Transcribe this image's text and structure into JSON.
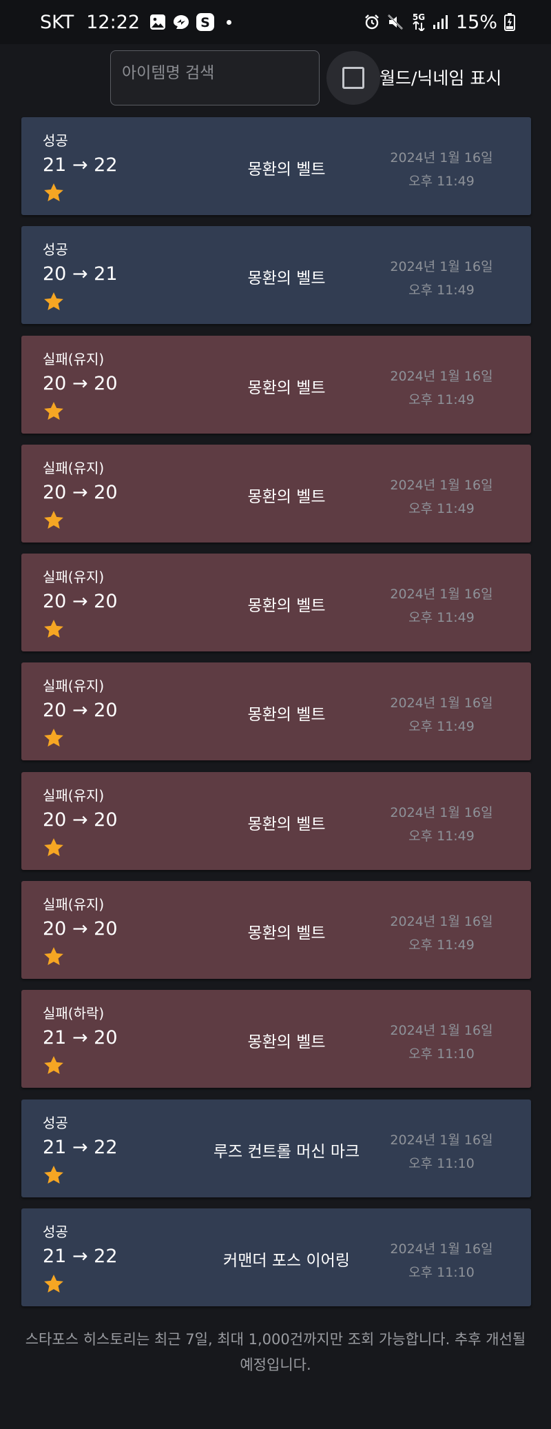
{
  "status_bar": {
    "carrier": "SKT",
    "time": "12:22",
    "network": "5G",
    "battery": "15%",
    "icons": [
      "gallery-icon",
      "messenger-icon",
      "s-app-icon",
      "notification-dot-icon",
      "alarm-icon",
      "mute-icon",
      "data-arrows-icon",
      "signal-icon",
      "battery-charging-icon"
    ]
  },
  "search": {
    "placeholder": "아이템명 검색",
    "value": ""
  },
  "world_toggle": {
    "label": "월드/닉네임 표시",
    "checked": false
  },
  "star_color": "#f6a623",
  "colors": {
    "success_card": "#323d52",
    "fail_card": "#5e3c43",
    "background": "#17181c"
  },
  "records": [
    {
      "result": "성공",
      "levels": "21 → 22",
      "item": "몽환의 벨트",
      "date": "2024년 1월 16일",
      "time": "오후 11:49",
      "status": "success"
    },
    {
      "result": "성공",
      "levels": "20 → 21",
      "item": "몽환의 벨트",
      "date": "2024년 1월 16일",
      "time": "오후 11:49",
      "status": "success"
    },
    {
      "result": "실패(유지)",
      "levels": "20 → 20",
      "item": "몽환의 벨트",
      "date": "2024년 1월 16일",
      "time": "오후 11:49",
      "status": "fail"
    },
    {
      "result": "실패(유지)",
      "levels": "20 → 20",
      "item": "몽환의 벨트",
      "date": "2024년 1월 16일",
      "time": "오후 11:49",
      "status": "fail"
    },
    {
      "result": "실패(유지)",
      "levels": "20 → 20",
      "item": "몽환의 벨트",
      "date": "2024년 1월 16일",
      "time": "오후 11:49",
      "status": "fail"
    },
    {
      "result": "실패(유지)",
      "levels": "20 → 20",
      "item": "몽환의 벨트",
      "date": "2024년 1월 16일",
      "time": "오후 11:49",
      "status": "fail"
    },
    {
      "result": "실패(유지)",
      "levels": "20 → 20",
      "item": "몽환의 벨트",
      "date": "2024년 1월 16일",
      "time": "오후 11:49",
      "status": "fail"
    },
    {
      "result": "실패(유지)",
      "levels": "20 → 20",
      "item": "몽환의 벨트",
      "date": "2024년 1월 16일",
      "time": "오후 11:49",
      "status": "fail"
    },
    {
      "result": "실패(하락)",
      "levels": "21 → 20",
      "item": "몽환의 벨트",
      "date": "2024년 1월 16일",
      "time": "오후 11:10",
      "status": "fail"
    },
    {
      "result": "성공",
      "levels": "21 → 22",
      "item": "루즈 컨트롤 머신 마크",
      "date": "2024년 1월 16일",
      "time": "오후 11:10",
      "status": "success"
    },
    {
      "result": "성공",
      "levels": "21 → 22",
      "item": "커맨더 포스 이어링",
      "date": "2024년 1월 16일",
      "time": "오후 11:10",
      "status": "success"
    }
  ],
  "footer": {
    "note": "스타포스 히스토리는 최근 7일, 최대 1,000건까지만 조회 가능합니다. 추후 개선될 예정입니다."
  }
}
